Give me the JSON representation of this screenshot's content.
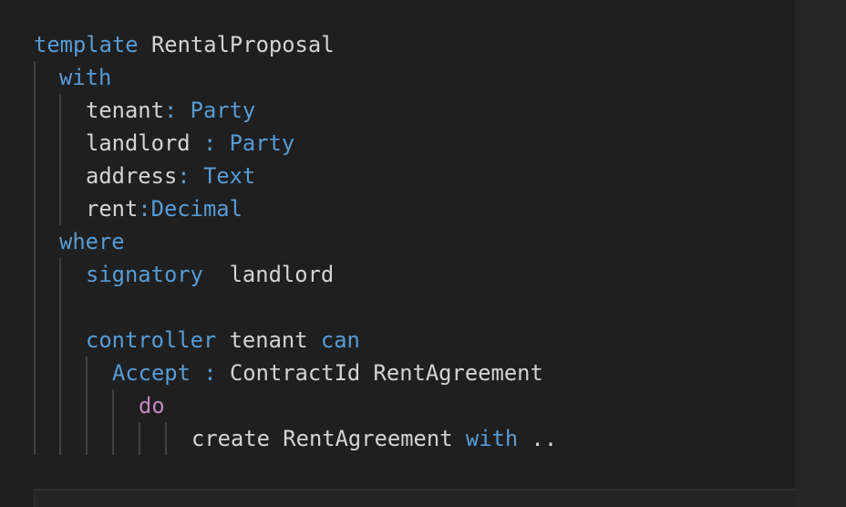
{
  "code": {
    "lines": [
      [
        {
          "t": "template",
          "c": "kw"
        },
        {
          "t": " RentalProposal",
          "c": "tx"
        }
      ],
      [
        {
          "t": "with",
          "c": "kw"
        }
      ],
      [
        {
          "t": "tenant",
          "c": "tx"
        },
        {
          "t": ": ",
          "c": "kw"
        },
        {
          "t": "Party",
          "c": "kw"
        }
      ],
      [
        {
          "t": "landlord ",
          "c": "tx"
        },
        {
          "t": ": ",
          "c": "kw"
        },
        {
          "t": "Party",
          "c": "kw"
        }
      ],
      [
        {
          "t": "address",
          "c": "tx"
        },
        {
          "t": ": ",
          "c": "kw"
        },
        {
          "t": "Text",
          "c": "kw"
        }
      ],
      [
        {
          "t": "rent",
          "c": "tx"
        },
        {
          "t": ":",
          "c": "kw"
        },
        {
          "t": "Decimal",
          "c": "kw"
        }
      ],
      [
        {
          "t": "where",
          "c": "kw"
        }
      ],
      [
        {
          "t": "signatory",
          "c": "kw"
        },
        {
          "t": "  landlord",
          "c": "tx"
        }
      ],
      [],
      [
        {
          "t": "controller",
          "c": "kw"
        },
        {
          "t": " tenant ",
          "c": "tx"
        },
        {
          "t": "can",
          "c": "kw"
        }
      ],
      [
        {
          "t": "Accept",
          "c": "kw"
        },
        {
          "t": " : ",
          "c": "kw"
        },
        {
          "t": "ContractId RentAgreement",
          "c": "tx"
        }
      ],
      [
        {
          "t": "do",
          "c": "pk"
        }
      ],
      [
        {
          "t": "create RentAgreement ",
          "c": "tx"
        },
        {
          "t": "with",
          "c": "kw"
        },
        {
          "t": " ..",
          "c": "tx"
        }
      ]
    ]
  },
  "colors": {
    "background": "#1f1f1f",
    "keyword": "#569cd6",
    "control_keyword": "#c586c0",
    "text": "#d4d4d4",
    "indent_guide": "#404040"
  }
}
